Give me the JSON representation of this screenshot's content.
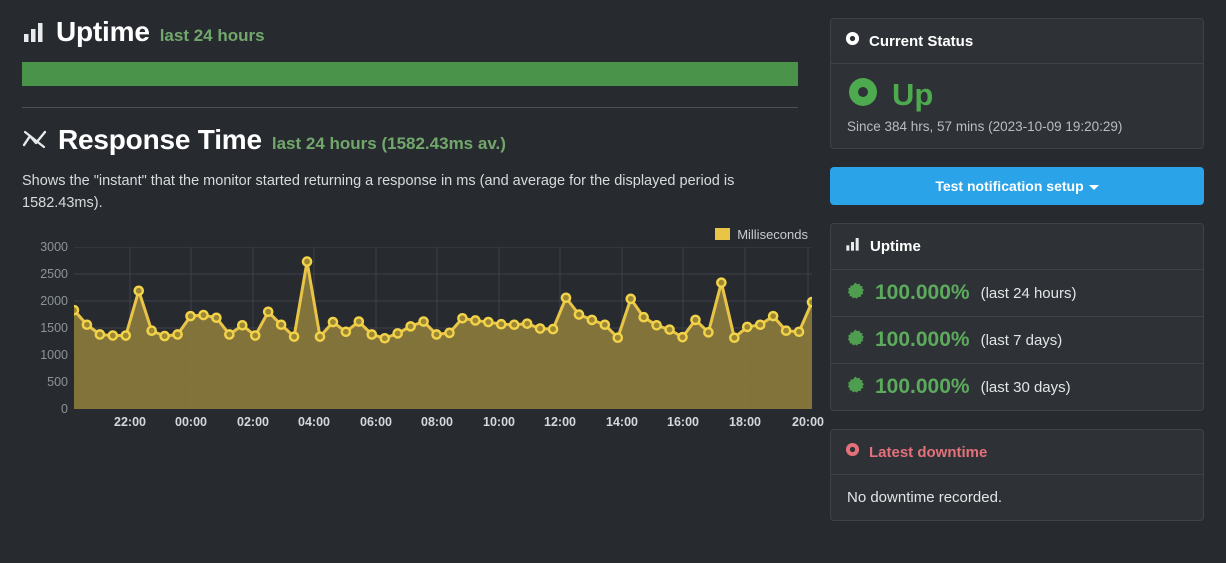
{
  "uptime_section": {
    "icon": "bar-chart-icon",
    "title": "Uptime",
    "subtitle": "last 24 hours",
    "bar_percent": 100,
    "bar_color": "#4a934a"
  },
  "response_section": {
    "icon": "line-chart-icon",
    "title": "Response Time",
    "subtitle": "last 24 hours (1582.43ms av.)",
    "description": "Shows the \"instant\" that the monitor started returning a response in ms (and average for the displayed period is 1582.43ms)."
  },
  "chart_data": {
    "type": "area",
    "title": "Response Time",
    "xlabel": "",
    "ylabel": "Milliseconds",
    "ylim": [
      0,
      3000
    ],
    "yticks": [
      0,
      500,
      1000,
      1500,
      2000,
      2500,
      3000
    ],
    "ytick_labels": [
      "0",
      "500",
      "1000",
      "1500",
      "2000",
      "2500",
      "3000"
    ],
    "xtick_labels": [
      "22:00",
      "00:00",
      "02:00",
      "04:00",
      "06:00",
      "08:00",
      "10:00",
      "12:00",
      "14:00",
      "16:00",
      "18:00",
      "20:00"
    ],
    "xtick_positions": [
      108,
      169,
      231,
      292,
      354,
      415,
      477,
      538,
      600,
      661,
      723,
      786
    ],
    "grid": true,
    "legend": {
      "position": "top-right",
      "entries": [
        "Milliseconds"
      ]
    },
    "line_color": "#e8c547",
    "fill_color": "#8a7a3c",
    "marker_color": "#f2d34a",
    "series": [
      {
        "name": "Milliseconds",
        "values": [
          1830,
          1560,
          1380,
          1360,
          1360,
          2190,
          1450,
          1350,
          1380,
          1720,
          1740,
          1690,
          1380,
          1550,
          1360,
          1800,
          1560,
          1340,
          2730,
          1340,
          1610,
          1430,
          1620,
          1380,
          1310,
          1400,
          1530,
          1620,
          1380,
          1410,
          1680,
          1640,
          1610,
          1570,
          1560,
          1580,
          1490,
          1480,
          2060,
          1750,
          1650,
          1560,
          1320,
          2040,
          1700,
          1550,
          1470,
          1330,
          1650,
          1420,
          2340,
          1320,
          1520,
          1560,
          1720,
          1450,
          1430,
          1980
        ]
      }
    ]
  },
  "sidebar": {
    "current_status": {
      "icon": "status-circle-icon",
      "header": "Current Status",
      "status_icon": "up-donut-icon",
      "status": "Up",
      "since": "Since 384 hrs, 57 mins (2023-10-09 19:20:29)",
      "color": "#4eaa4e"
    },
    "notification_button": {
      "label": "Test notification setup",
      "icon": "caret-down-icon",
      "color": "#2aa3e8"
    },
    "uptime_panel": {
      "icon": "bar-chart-icon",
      "header": "Uptime",
      "rows": [
        {
          "icon": "badge-icon",
          "percent": "100.000%",
          "period": "(last 24 hours)"
        },
        {
          "icon": "badge-icon",
          "percent": "100.000%",
          "period": "(last 7 days)"
        },
        {
          "icon": "badge-icon",
          "percent": "100.000%",
          "period": "(last 30 days)"
        }
      ]
    },
    "downtime_panel": {
      "icon": "alert-circle-icon",
      "header": "Latest downtime",
      "message": "No downtime recorded.",
      "color": "#e4707a"
    }
  }
}
